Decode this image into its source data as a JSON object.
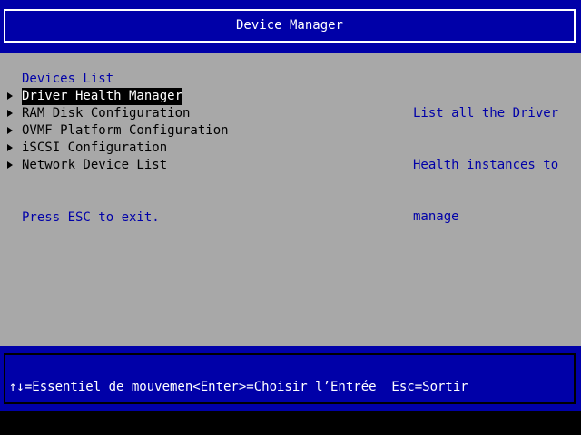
{
  "header": {
    "title": "Device Manager"
  },
  "main": {
    "section_title": "Devices List",
    "items": [
      {
        "label": "Driver Health Manager",
        "selected": true
      },
      {
        "label": "RAM Disk Configuration",
        "selected": false
      },
      {
        "label": "OVMF Platform Configuration",
        "selected": false
      },
      {
        "label": "iSCSI Configuration",
        "selected": false
      },
      {
        "label": "Network Device List",
        "selected": false
      }
    ],
    "exit_hint": "Press ESC to exit."
  },
  "help": {
    "lines": [
      "List all the Driver",
      "Health instances to",
      "manage"
    ]
  },
  "footer": {
    "keys": "↑↓=Essentiel de mouvemen<Enter>=Choisir l’Entrée  Esc=Sortir"
  },
  "colors": {
    "blue": "#0000a8",
    "gray": "#a8a8a8",
    "white": "#ffffff",
    "black": "#000000"
  },
  "icons": {
    "menu_marker": "right-triangle-icon"
  }
}
